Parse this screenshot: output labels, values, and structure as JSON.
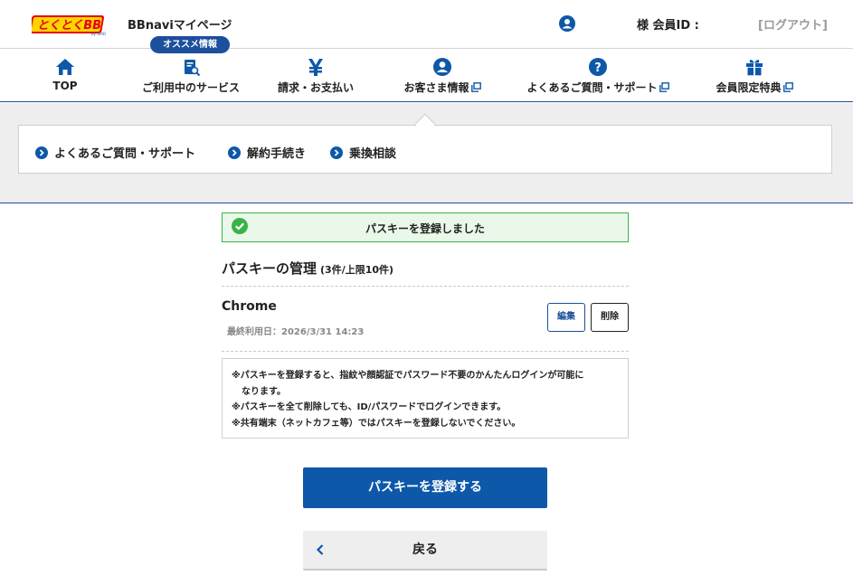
{
  "header": {
    "logo_text": "とくとくBB",
    "logo_sub": "by GMO",
    "site_title": "BBnaviマイページ",
    "member_label": "様 会員ID :",
    "logout": "[ログアウト]"
  },
  "nav": {
    "badge": "オススメ情報",
    "items": [
      {
        "label": "TOP",
        "icon": "home-icon"
      },
      {
        "label": "ご利用中のサービス",
        "icon": "service-icon"
      },
      {
        "label": "請求・お支払い",
        "icon": "yen-icon"
      },
      {
        "label": "お客さま情報",
        "icon": "user-icon"
      },
      {
        "label": "よくあるご質問・サポート",
        "icon": "question-icon"
      },
      {
        "label": "会員限定特典",
        "icon": "gift-icon"
      }
    ]
  },
  "subnav": {
    "links": [
      "よくあるご質問・サポート",
      "解約手続き",
      "乗換相談"
    ]
  },
  "alert": {
    "message": "パスキーを登録しました"
  },
  "passkeys": {
    "title": "パスキーの管理",
    "count": "(3件/上限10件)",
    "item": {
      "name": "Chrome",
      "last_used": "最終利用日：2026/3/31 14:23",
      "edit_label": "編集",
      "delete_label": "削除"
    }
  },
  "notes": {
    "line1": "※パスキーを登録すると、指紋や顔認証でパスワード不要のかんたんログインが可能に",
    "line1b": "なります。",
    "line2": "※パスキーを全て削除しても、ID/パスワードでログインできます。",
    "line3": "※共有端末（ネットカフェ等）ではパスキーを登録しないでください。"
  },
  "actions": {
    "register": "パスキーを登録する",
    "back": "戻る"
  },
  "colors": {
    "brand_blue": "#0d58a8",
    "nav_blue": "#1c4f9c",
    "success_green": "#39b24a",
    "success_bg": "#e9f8e9"
  }
}
